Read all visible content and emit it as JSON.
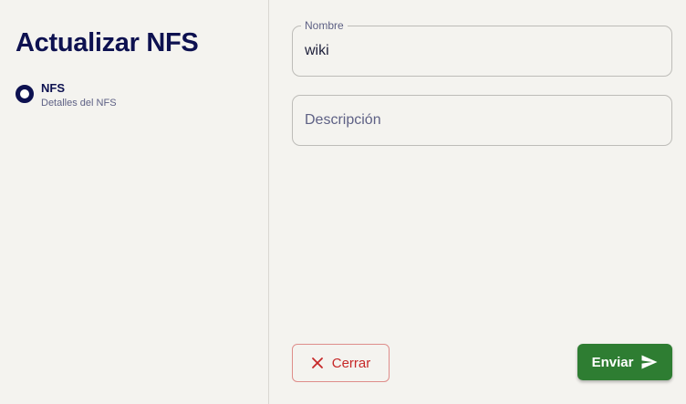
{
  "sidebar": {
    "title": "Actualizar NFS",
    "steps": [
      {
        "title": "NFS",
        "subtitle": "Detalles del NFS"
      }
    ]
  },
  "form": {
    "name": {
      "label": "Nombre",
      "value": "wiki"
    },
    "description": {
      "placeholder": "Descripción",
      "value": ""
    }
  },
  "actions": {
    "cancel_label": "Cerrar",
    "cancel_icon": "close-icon",
    "submit_label": "Enviar",
    "submit_icon": "send-icon"
  },
  "colors": {
    "primary": "#0d1150",
    "success": "#2e7d32",
    "danger": "#c62828",
    "background": "#f4f3ef"
  }
}
